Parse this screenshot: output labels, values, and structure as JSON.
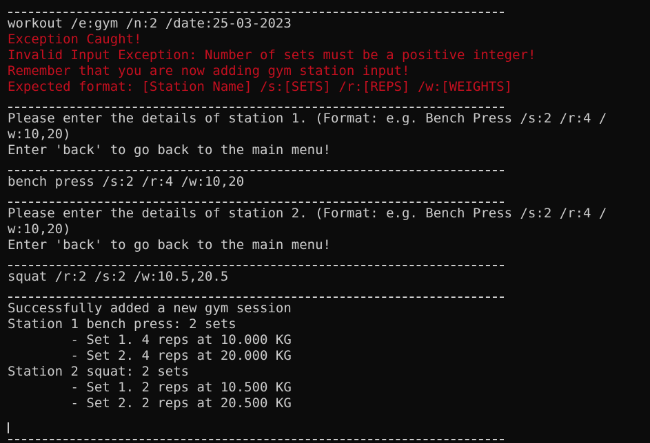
{
  "window": {
    "background": "#0c0c0c",
    "text_color": "#cccccc",
    "error_color": "#c50f1f"
  },
  "lines": [
    {
      "kind": "sep",
      "text": ""
    },
    {
      "kind": "text",
      "text": "workout /e:gym /n:2 /date:25-03-2023"
    },
    {
      "kind": "error",
      "text": "Exception Caught!"
    },
    {
      "kind": "error",
      "text": "Invalid Input Exception: Number of sets must be a positive integer!"
    },
    {
      "kind": "error",
      "text": "Remember that you are now adding gym station input!"
    },
    {
      "kind": "error",
      "text": "Expected format: [Station Name] /s:[SETS] /r:[REPS] /w:[WEIGHTS]"
    },
    {
      "kind": "sep",
      "text": ""
    },
    {
      "kind": "text",
      "text": "Please enter the details of station 1. (Format: e.g. Bench Press /s:2 /r:4 /"
    },
    {
      "kind": "text",
      "text": "w:10,20)"
    },
    {
      "kind": "text",
      "text": "Enter 'back' to go back to the main menu!"
    },
    {
      "kind": "sep",
      "text": ""
    },
    {
      "kind": "text",
      "text": "bench press /s:2 /r:4 /w:10,20"
    },
    {
      "kind": "sep",
      "text": ""
    },
    {
      "kind": "text",
      "text": "Please enter the details of station 2. (Format: e.g. Bench Press /s:2 /r:4 /"
    },
    {
      "kind": "text",
      "text": "w:10,20)"
    },
    {
      "kind": "text",
      "text": "Enter 'back' to go back to the main menu!"
    },
    {
      "kind": "sep",
      "text": ""
    },
    {
      "kind": "text",
      "text": "squat /r:2 /s:2 /w:10.5,20.5"
    },
    {
      "kind": "sep",
      "text": ""
    },
    {
      "kind": "text",
      "text": "Successfully added a new gym session"
    },
    {
      "kind": "text",
      "text": "Station 1 bench press: 2 sets"
    },
    {
      "kind": "text",
      "text": "        - Set 1. 4 reps at 10.000 KG"
    },
    {
      "kind": "text",
      "text": "        - Set 2. 4 reps at 20.000 KG"
    },
    {
      "kind": "text",
      "text": "Station 2 squat: 2 sets"
    },
    {
      "kind": "text",
      "text": "        - Set 1. 2 reps at 10.500 KG"
    },
    {
      "kind": "text",
      "text": "        - Set 2. 2 reps at 20.500 KG"
    },
    {
      "kind": "text",
      "text": ""
    },
    {
      "kind": "sep",
      "text": ""
    }
  ]
}
